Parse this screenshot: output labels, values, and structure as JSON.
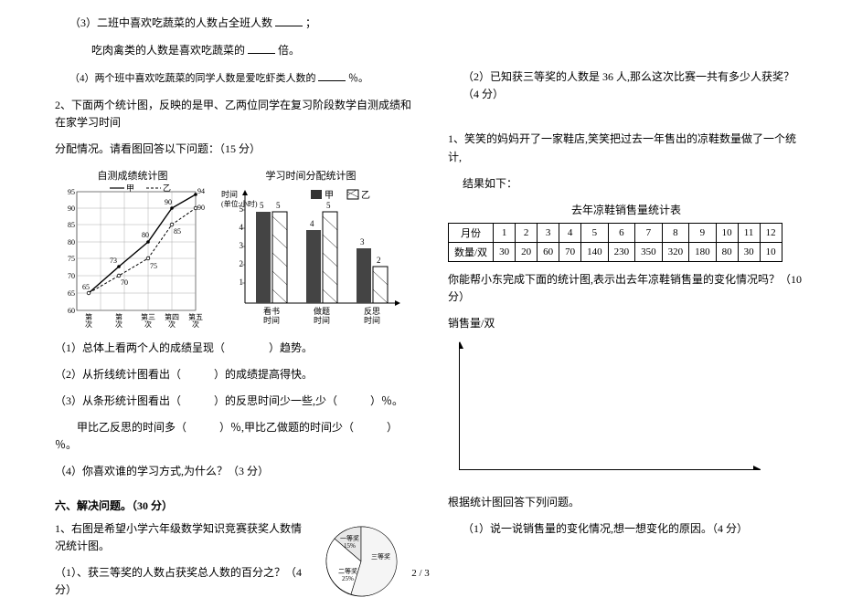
{
  "left": {
    "q3_a": "（3）二班中喜欢吃蔬菜的人数占全班人数",
    "q3_a_tail": "；",
    "q3_b_pre": "吃肉禽类的人数是喜欢吃蔬菜的",
    "q3_b_tail": "倍。",
    "q4": "（4）两个班中喜欢吃蔬菜的同学人数是爱吃虾类人数的",
    "q4_tail": "％。",
    "p2_intro_a": "2、下面两个统计图，反映的是甲、乙两位同学在复习阶段数学自测成绩和在家学习时间",
    "p2_intro_b": "分配情况。请看图回答以下问题：（15 分）",
    "chart1_title": "自测成绩统计图",
    "chart2_title": "学习时间分配统计图",
    "chart1": {
      "legend_a": "甲",
      "legend_b": "乙",
      "y_ticks": [
        "60",
        "65",
        "70",
        "75",
        "80",
        "85",
        "90",
        "95"
      ],
      "x_ticks": [
        "第一次",
        "第二次",
        "第三次",
        "第四次",
        "第五次"
      ],
      "series_a": [
        65,
        73,
        80,
        90,
        94
      ],
      "series_b": [
        65,
        70,
        75,
        85,
        90
      ],
      "labels": {
        "65": "65",
        "70": "70",
        "73": "73",
        "75": "75",
        "80": "80",
        "85": "85",
        "90": "90",
        "94": "94"
      }
    },
    "chart2": {
      "y_label": "时间\\n(单位:小时)",
      "legend_a": "甲",
      "legend_b": "乙",
      "categories": [
        "看书\\n时间",
        "做题\\n时间",
        "反思\\n时间"
      ],
      "series_a": [
        5,
        4,
        3
      ],
      "series_b": [
        5,
        5,
        2
      ],
      "y_ticks": [
        "1",
        "2",
        "3",
        "4",
        "5"
      ]
    },
    "q_list": {
      "q1": "（1）总体上看两个人的成绩呈现（　　　　）趋势。",
      "q2": "（2）从折线统计图看出（　　　）的成绩提高得快。",
      "q3": "（3）从条形统计图看出（　　　）的反思时间少一些,少（　　　）％。",
      "q3b": "　　甲比乙反思的时间多（　　　）％,甲比乙做题的时间少（　　　）％。",
      "q4": "（4）你喜欢谁的学习方式,为什么？（3 分）"
    },
    "section6": "六、解决问题。（30 分）",
    "p6_1": "1、右图是希望小学六年级数学知识竞赛获奖人数情况统计图。",
    "p6_1_q1": "（1）、获三等奖的人数占获奖总人数的百分之？（4 分）",
    "pie": {
      "first": "一等奖\\n15%",
      "second": "二等奖\\n25%",
      "third": "三等奖"
    }
  },
  "right": {
    "p6_1_q2": "（2）已知获三等奖的人数是 36 人,那么这次比赛一共有多少人获奖？（4 分）",
    "p1_a": "1、笑笑的妈妈开了一家鞋店,笑笑把过去一年售出的凉鞋数量做了一个统计,",
    "p1_b": "结果如下：",
    "table_title": "去年凉鞋销售量统计表",
    "table": {
      "row_head": "月份",
      "row1": [
        "1",
        "2",
        "3",
        "4",
        "5",
        "6",
        "7",
        "8",
        "9",
        "10",
        "11",
        "12"
      ],
      "row2_head": "数量/双",
      "row2": [
        "30",
        "20",
        "60",
        "70",
        "140",
        "230",
        "350",
        "320",
        "180",
        "80",
        "30",
        "10"
      ]
    },
    "p1_c": "你能帮小东完成下面的统计图,表示出去年凉鞋销售量的变化情况吗？（10 分）",
    "axis_y": "销售量/双",
    "below_title": "根据统计图回答下列问题。",
    "below_q1": "（1）说一说销售量的变化情况,想一想变化的原因。（4 分）"
  },
  "page": "2 / 3",
  "chart_data": [
    {
      "type": "line",
      "title": "自测成绩统计图",
      "categories": [
        "第一次",
        "第二次",
        "第三次",
        "第四次",
        "第五次"
      ],
      "series": [
        {
          "name": "甲",
          "values": [
            65,
            73,
            80,
            90,
            94
          ]
        },
        {
          "name": "乙",
          "values": [
            65,
            70,
            75,
            85,
            90
          ]
        }
      ],
      "ylim": [
        60,
        95
      ]
    },
    {
      "type": "bar",
      "title": "学习时间分配统计图",
      "ylabel": "时间(单位:小时)",
      "categories": [
        "看书时间",
        "做题时间",
        "反思时间"
      ],
      "series": [
        {
          "name": "甲",
          "values": [
            5,
            4,
            3
          ]
        },
        {
          "name": "乙",
          "values": [
            5,
            5,
            2
          ]
        }
      ],
      "ylim": [
        0,
        5
      ]
    },
    {
      "type": "pie",
      "title": "获奖人数情况统计图",
      "slices": [
        {
          "name": "一等奖",
          "value": 15
        },
        {
          "name": "二等奖",
          "value": 25
        },
        {
          "name": "三等奖",
          "value": 60
        }
      ]
    },
    {
      "type": "table",
      "title": "去年凉鞋销售量统计表",
      "categories": [
        "1",
        "2",
        "3",
        "4",
        "5",
        "6",
        "7",
        "8",
        "9",
        "10",
        "11",
        "12"
      ],
      "values": [
        30,
        20,
        60,
        70,
        140,
        230,
        350,
        320,
        180,
        80,
        30,
        10
      ],
      "xlabel": "月份",
      "ylabel": "数量/双"
    }
  ]
}
